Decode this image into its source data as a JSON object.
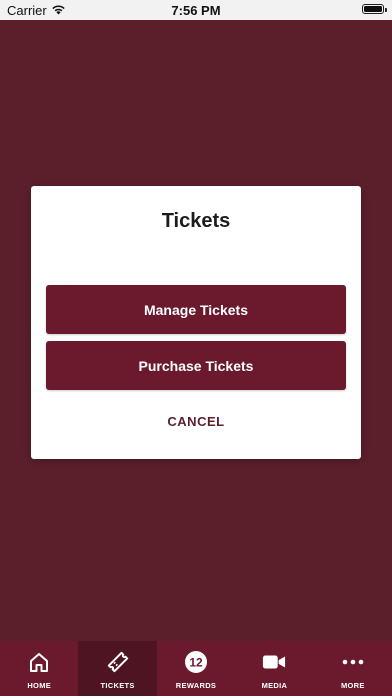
{
  "status_bar": {
    "carrier": "Carrier",
    "time": "7:56 PM"
  },
  "dialog": {
    "title": "Tickets",
    "manage_label": "Manage Tickets",
    "purchase_label": "Purchase Tickets",
    "cancel_label": "CANCEL"
  },
  "tab_bar": {
    "active": "tickets",
    "items": [
      {
        "label": "HOME",
        "icon": "home-icon"
      },
      {
        "label": "TICKETS",
        "icon": "ticket-icon"
      },
      {
        "label": "REWARDS",
        "icon": "rewards-12-icon",
        "icon_text": "12"
      },
      {
        "label": "MEDIA",
        "icon": "video-camera-icon"
      },
      {
        "label": "MORE",
        "icon": "more-dots-icon"
      }
    ]
  },
  "colors": {
    "background": "#5a1f2b",
    "accent": "#6b1a2d",
    "tab_active": "#4e1421"
  }
}
